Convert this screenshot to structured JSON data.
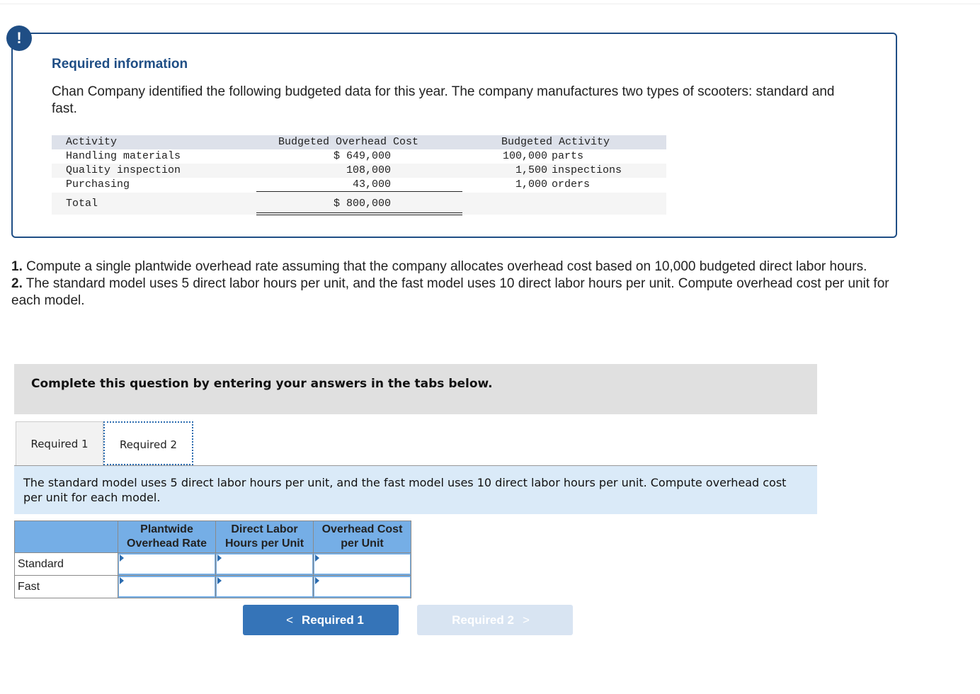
{
  "alert": {
    "icon": "!",
    "title": "Required information",
    "text": "Chan Company identified the following budgeted data for this year. The company manufactures two types of scooters: standard and fast."
  },
  "budget_table": {
    "headers": {
      "activity": "Activity",
      "cost": "Budgeted Overhead Cost",
      "budgeted_activity": "Budgeted Activity"
    },
    "rows": [
      {
        "activity": "Handling materials",
        "cost": "$ 649,000",
        "amount": "100,000",
        "unit": "parts"
      },
      {
        "activity": "Quality inspection",
        "cost": "108,000",
        "amount": "1,500",
        "unit": "inspections"
      },
      {
        "activity": "Purchasing",
        "cost": "43,000",
        "amount": "1,000",
        "unit": "orders"
      }
    ],
    "total": {
      "label": "Total",
      "cost": "$ 800,000"
    }
  },
  "questions": [
    {
      "num": "1.",
      "text": " Compute a single plantwide overhead rate assuming that the company allocates overhead cost based on 10,000 budgeted direct labor hours."
    },
    {
      "num": "2.",
      "text": " The standard model uses 5 direct labor hours per unit, and the fast model uses 10 direct labor hours per unit. Compute overhead cost per unit for each model."
    }
  ],
  "banner": "Complete this question by entering your answers in the tabs below.",
  "tabs": [
    {
      "label": "Required 1",
      "active": false
    },
    {
      "label": "Required 2",
      "active": true
    }
  ],
  "instruction": "The standard model uses 5 direct labor hours per unit, and the fast model uses 10 direct labor hours per unit. Compute overhead cost per unit for each model.",
  "answer_table": {
    "columns": [
      {
        "line1": "Plantwide",
        "line2": "Overhead Rate"
      },
      {
        "line1": "Direct Labor",
        "line2": "Hours per Unit"
      },
      {
        "line1": "Overhead Cost",
        "line2": "per Unit"
      }
    ],
    "rows": [
      {
        "label": "Standard",
        "values": [
          "",
          "",
          ""
        ]
      },
      {
        "label": "Fast",
        "values": [
          "",
          "",
          ""
        ]
      }
    ]
  },
  "nav": {
    "prev_label": "Required 1",
    "next_label": "Required 2",
    "prev_icon": "chevron-left-icon",
    "next_icon": "chevron-right-icon",
    "prev_glyph": "<",
    "next_glyph": ">"
  },
  "colors": {
    "accent": "#1f4e85",
    "button": "#3574b8",
    "button_disabled": "#d8e4f2",
    "table_header": "#75aee6",
    "instruction_bg": "#daeaf8"
  }
}
